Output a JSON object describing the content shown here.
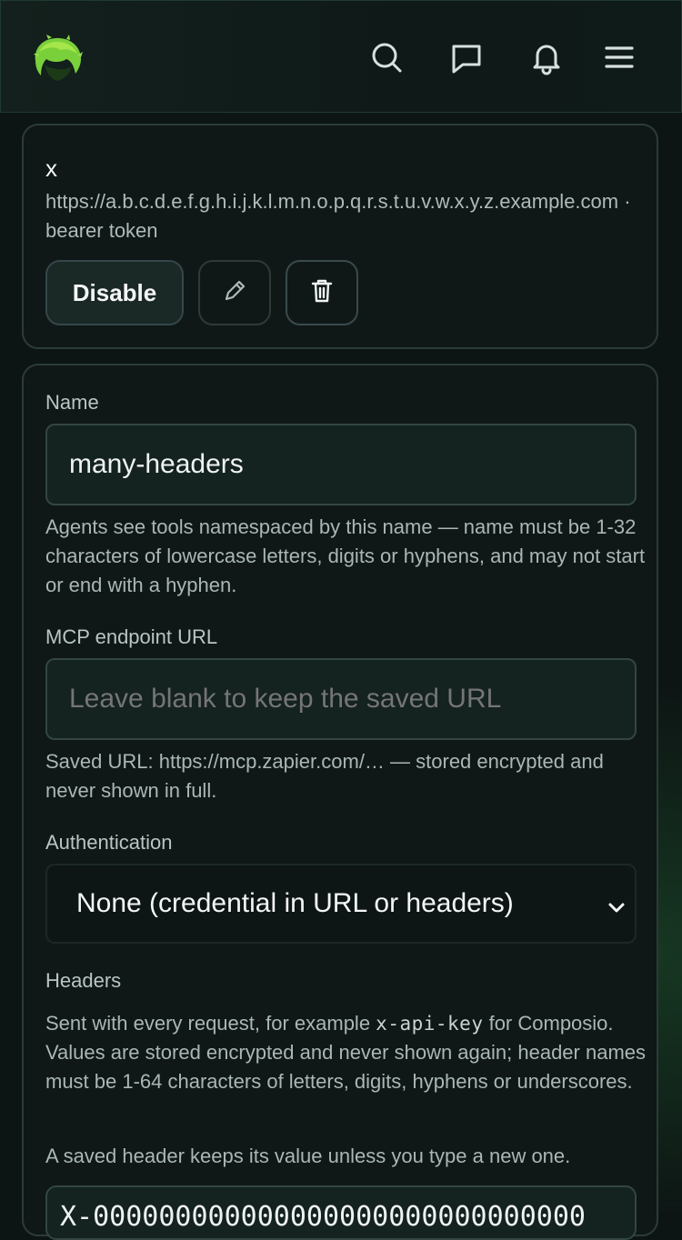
{
  "header": {
    "icons": [
      "search-icon",
      "chat-icon",
      "bell-icon",
      "menu-icon"
    ]
  },
  "server": {
    "name": "x",
    "meta": "https://a.b.c.d.e.f.g.h.i.j.k.l.m.n.o.p.q.r.s.t.u.v.w.x.y.z.example.com · bearer token",
    "disable_label": "Disable"
  },
  "form": {
    "name_label": "Name",
    "name_value": "many-headers",
    "name_help": "Agents see tools namespaced by this name — name must be 1-32 characters of lowercase letters, digits or hyphens, and may not start or end with a hyphen.",
    "url_label": "MCP endpoint URL",
    "url_placeholder": "Leave blank to keep the saved URL",
    "url_help": "Saved URL: https://mcp.zapier.com/… — stored encrypted and never shown in full.",
    "auth_label": "Authentication",
    "auth_selected": "None (credential in URL or headers)",
    "headers_label": "Headers",
    "headers_help_pre": "Sent with every request, for example ",
    "headers_help_code": "x-api-key",
    "headers_help_post": " for Composio. Values are stored encrypted and never shown again; header names must be 1-64 characters of letters, digits, hyphens or underscores.",
    "headers_keep_note": "A saved header keeps its value unless you type a new one.",
    "header_row_peek": "X-000000000000000000000000000000"
  },
  "colors": {
    "background": "#0d1514",
    "accent": "#7ad03a",
    "card_border": "#2b3b38"
  }
}
